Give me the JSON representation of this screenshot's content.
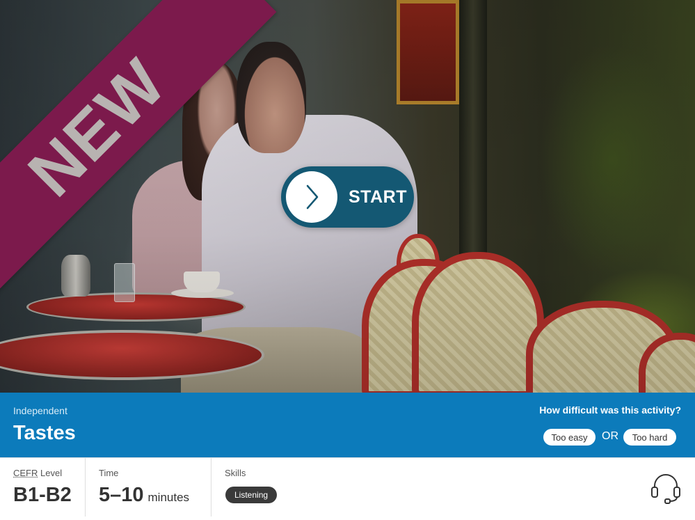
{
  "hero": {
    "badge": "NEW",
    "start_label": "START",
    "start_icon": "chevron-right-icon"
  },
  "activity": {
    "category": "Independent",
    "title": "Tastes"
  },
  "feedback": {
    "question": "How difficult was this activity?",
    "too_easy_label": "Too easy",
    "or_label": "OR",
    "too_hard_label": "Too hard"
  },
  "stats": {
    "cefr_abbr": "CEFR",
    "cefr_label_suffix": " Level",
    "cefr_value": "B1-B2",
    "time_label": "Time",
    "time_value": "5–10",
    "time_unit": "minutes",
    "skills_label": "Skills",
    "skills": [
      "Listening"
    ],
    "skill_icon": "headset-icon"
  },
  "colors": {
    "ribbon": "#7c1a4c",
    "start_button": "#145873",
    "info_bar": "#0c7bbb",
    "skill_pill": "#3a3a3a"
  }
}
